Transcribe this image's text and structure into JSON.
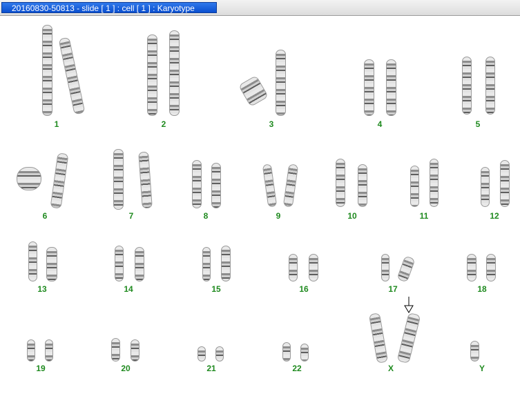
{
  "window": {
    "title": "20160830-50813 - slide [ 1 ] : cell [ 1 ] : Karyotype"
  },
  "karyotype": {
    "label_color": "#1f8a1f",
    "labels": [
      "1",
      "2",
      "3",
      "4",
      "5",
      "6",
      "7",
      "8",
      "9",
      "10",
      "11",
      "12",
      "13",
      "14",
      "15",
      "16",
      "17",
      "18",
      "19",
      "20",
      "21",
      "22",
      "X",
      "Y"
    ],
    "marker_icon": "arrow-down-icon"
  }
}
